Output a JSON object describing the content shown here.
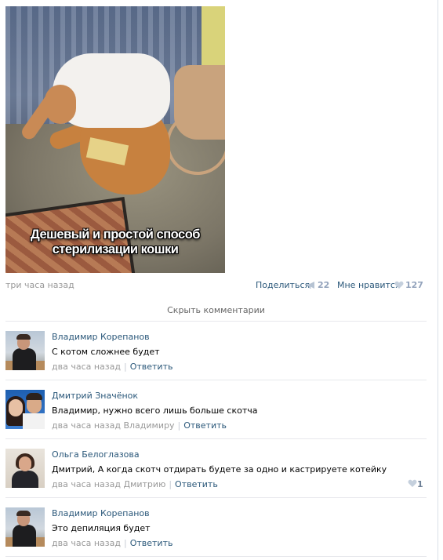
{
  "post": {
    "caption_line1": "Дешевый и простой способ",
    "caption_line2": "стерилизации кошки",
    "time": "три часа назад",
    "share_label": "Поделиться",
    "share_count": "22",
    "like_label": "Мне нравится",
    "like_count": "127"
  },
  "comments_toggle": "Скрыть комментарии",
  "comments": [
    {
      "author": "Владимир Корепанов",
      "text": "С котом сложнее будет",
      "time": "два часа назад",
      "reply_to": "",
      "reply_label": "Ответить",
      "likes": ""
    },
    {
      "author": "Дмитрий Значёнок",
      "text": "Владимир, нужно всего лишь больше скотча",
      "time": "два часа назад",
      "reply_to": "Владимиру",
      "reply_label": "Ответить",
      "likes": ""
    },
    {
      "author": "Ольга Белоглазова",
      "text": "Дмитрий, А когда скотч отдирать будете за одно и кастрируете котейку",
      "time": "два часа назад",
      "reply_to": "Дмитрию",
      "reply_label": "Ответить",
      "likes": "1"
    },
    {
      "author": "Владимир Корепанов",
      "text": "Это депиляция будет",
      "time": "два часа назад",
      "reply_to": "",
      "reply_label": "Ответить",
      "likes": ""
    }
  ],
  "icons": {
    "share": "megaphone-icon",
    "like": "heart-icon"
  },
  "colors": {
    "link": "#2b587a",
    "muted": "#999999",
    "count": "#93a3bc",
    "divider": "#e7e8ec"
  }
}
